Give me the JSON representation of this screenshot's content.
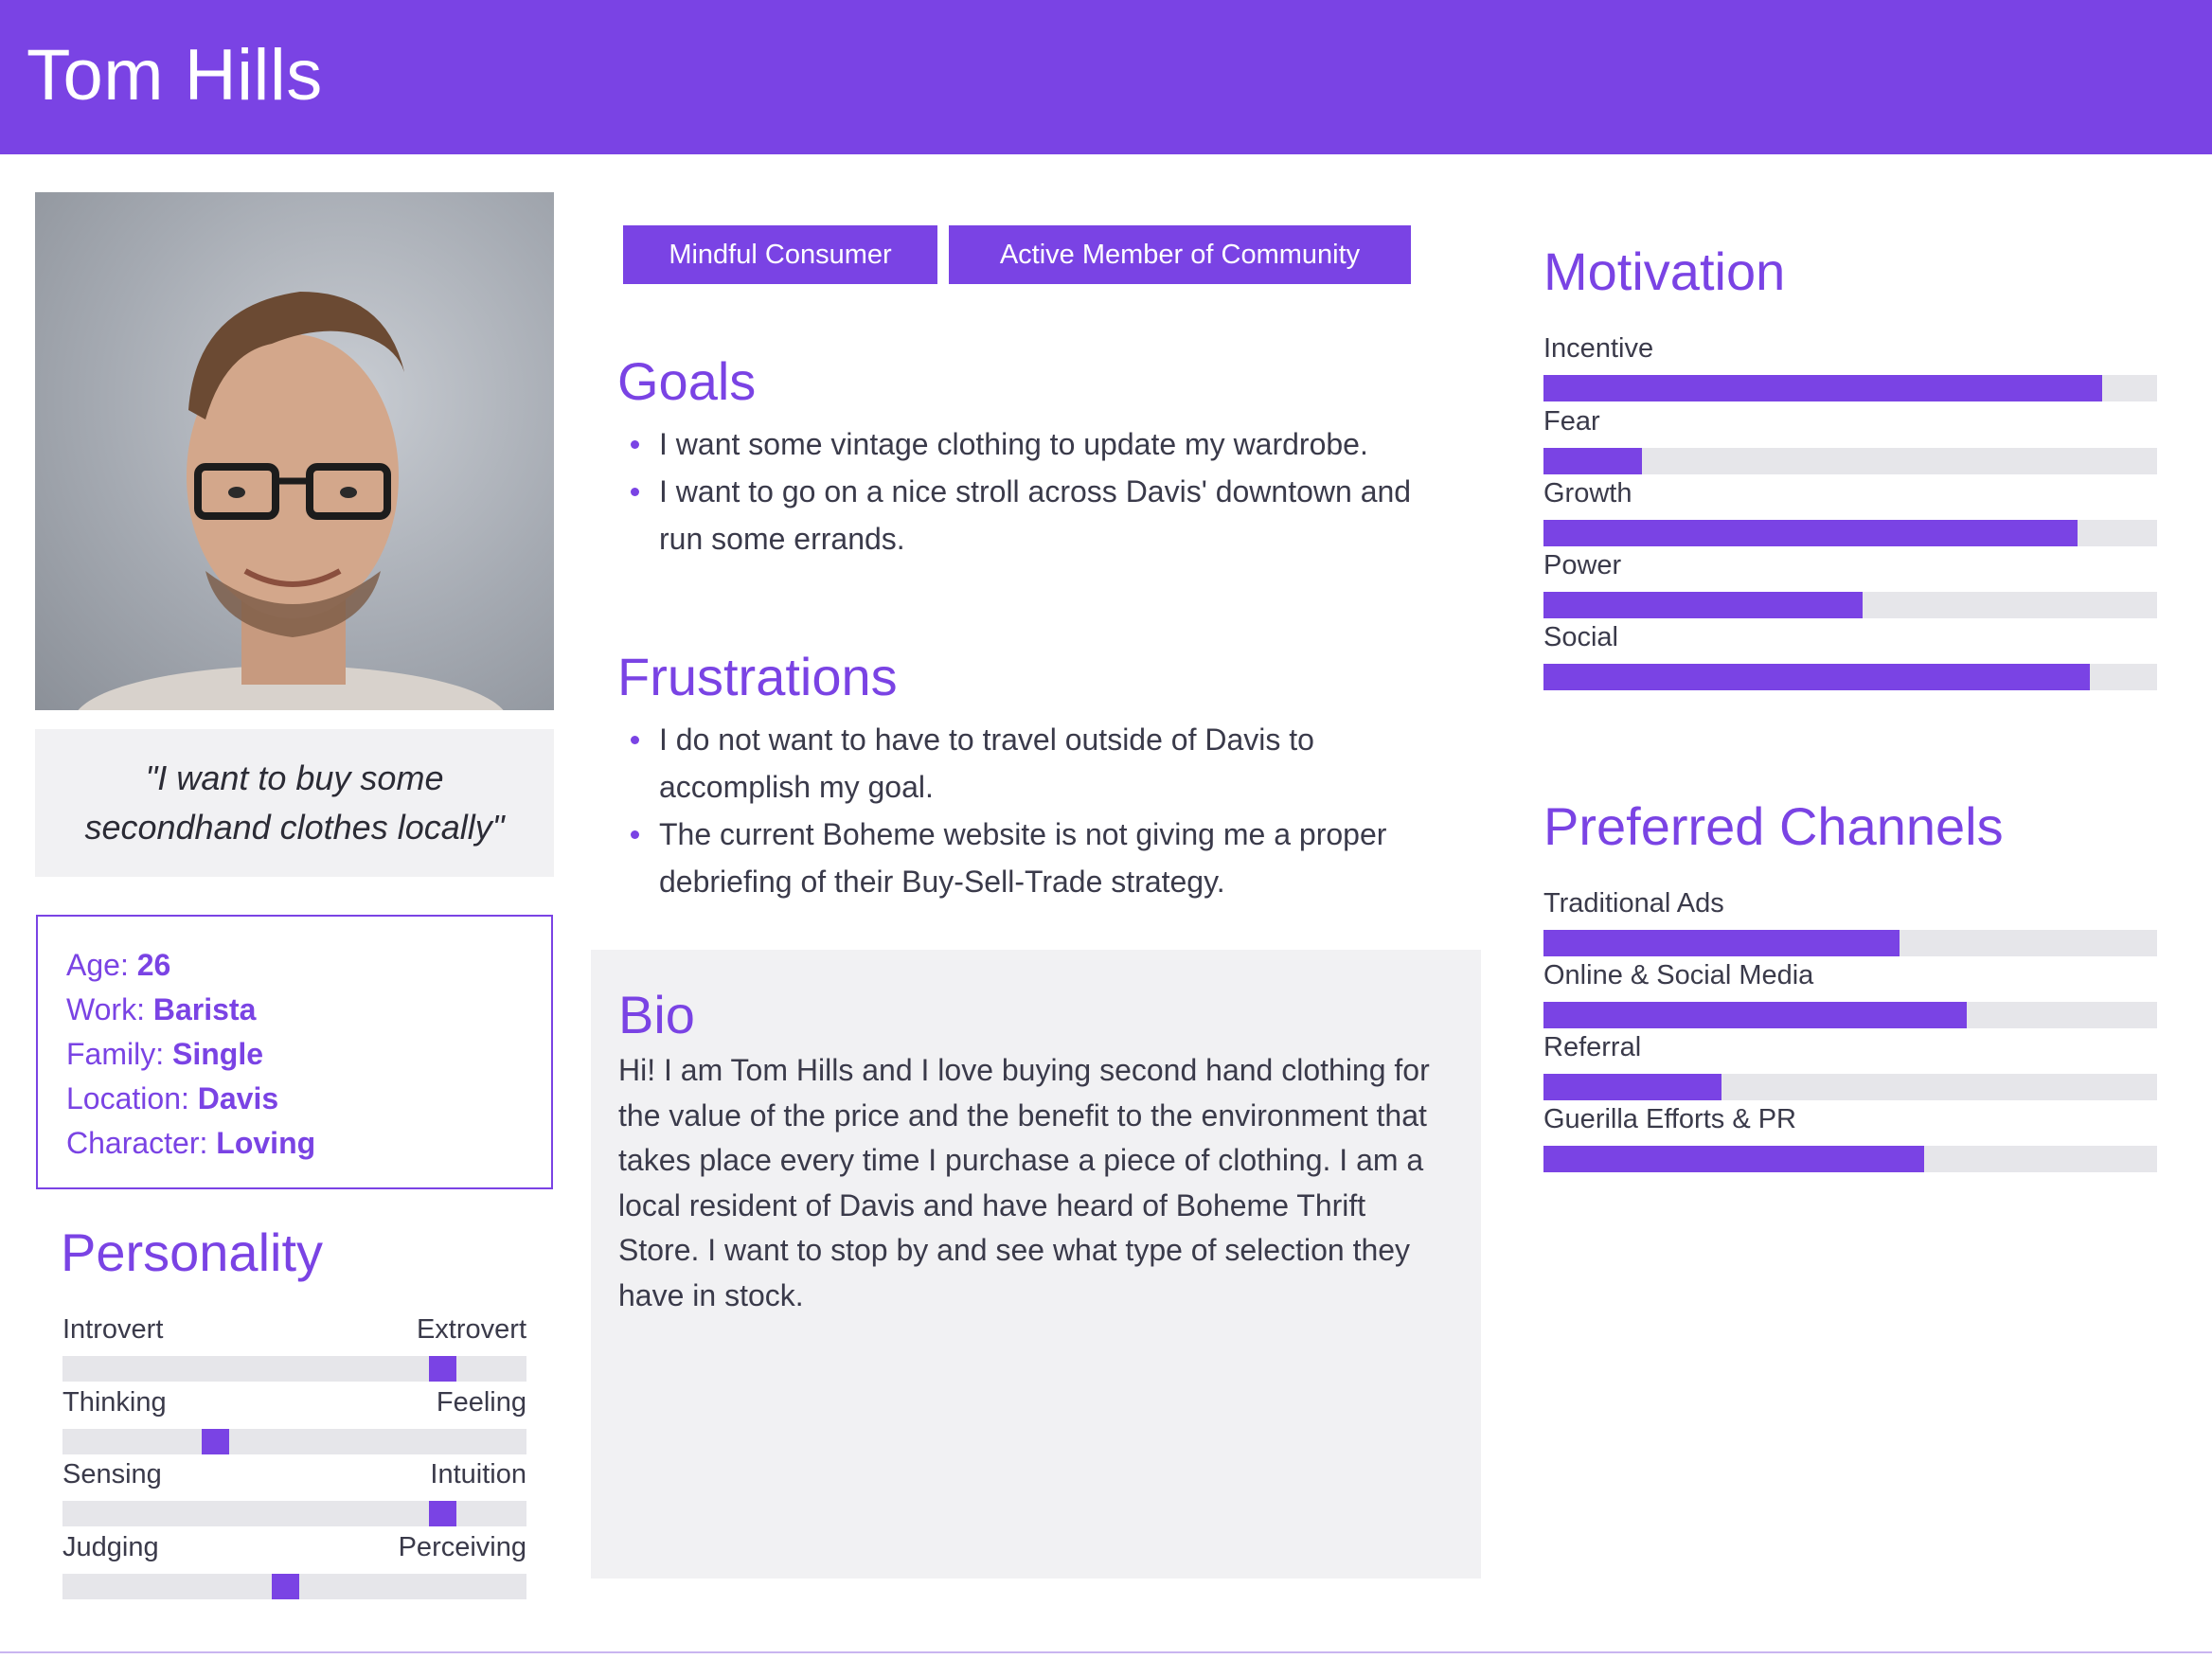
{
  "header": {
    "name": "Tom Hills"
  },
  "quote": "\"I want to buy some secondhand clothes locally\"",
  "info": [
    {
      "label": "Age:",
      "value": "26"
    },
    {
      "label": "Work:",
      "value": "Barista"
    },
    {
      "label": "Family:",
      "value": "Single"
    },
    {
      "label": "Location:",
      "value": "Davis"
    },
    {
      "label": "Character:",
      "value": "Loving"
    }
  ],
  "personality": {
    "title": "Personality",
    "scales": [
      {
        "left": "Introvert",
        "right": "Extrovert",
        "level": 0.82
      },
      {
        "left": "Thinking",
        "right": "Feeling",
        "level": 0.33
      },
      {
        "left": "Sensing",
        "right": "Intuition",
        "level": 0.82
      },
      {
        "left": "Judging",
        "right": "Perceiving",
        "level": 0.48
      }
    ]
  },
  "tags": [
    "Mindful Consumer",
    "Active Member of Community"
  ],
  "goals": {
    "title": "Goals",
    "items": [
      "I want some vintage clothing to update my wardrobe.",
      "I want to go on a nice stroll across Davis' downtown and run some errands."
    ]
  },
  "frustrations": {
    "title": "Frustrations",
    "items": [
      "I do not want to have to travel outside of Davis to accomplish my goal.",
      "The current Boheme website is not giving me a proper debriefing of their Buy-Sell-Trade strategy."
    ]
  },
  "bio": {
    "title": "Bio",
    "text": "Hi! I am Tom Hills and I love buying second hand clothing for the value of the price and the benefit to the environment that takes place every time I purchase a piece of clothing. I am a local resident of Davis and have heard of Boheme Thrift Store. I want to stop by and see what type of selection they have in stock."
  },
  "motivation": {
    "title": "Motivation",
    "items": [
      {
        "label": "Incentive",
        "level": 0.91
      },
      {
        "label": "Fear",
        "level": 0.16
      },
      {
        "label": "Growth",
        "level": 0.87
      },
      {
        "label": "Power",
        "level": 0.52
      },
      {
        "label": "Social",
        "level": 0.89
      }
    ]
  },
  "channels": {
    "title": "Preferred Channels",
    "items": [
      {
        "label": "Traditional Ads",
        "level": 0.58
      },
      {
        "label": "Online & Social Media",
        "level": 0.69
      },
      {
        "label": "Referral",
        "level": 0.29
      },
      {
        "label": "Guerilla Efforts & PR",
        "level": 0.62
      }
    ]
  },
  "colors": {
    "accent": "#7a43e4",
    "panel": "#f1f1f3",
    "track": "#e6e6ea"
  }
}
